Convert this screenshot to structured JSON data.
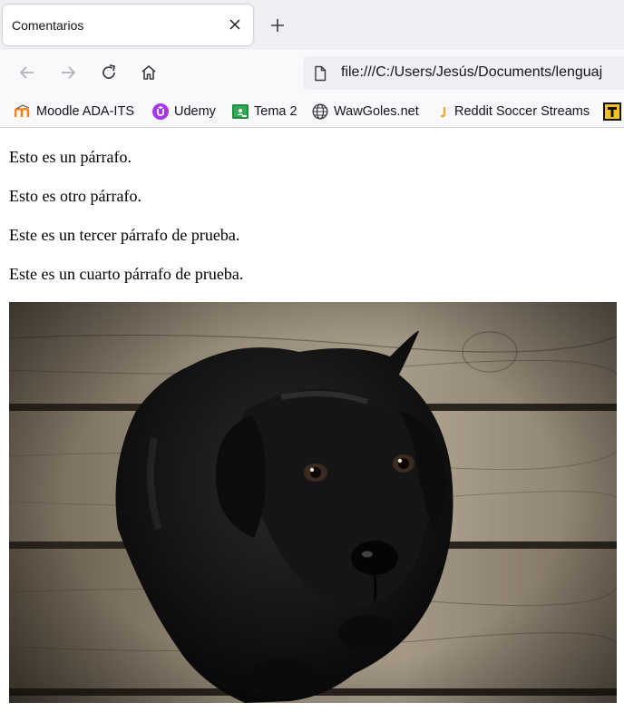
{
  "tab": {
    "title": "Comentarios"
  },
  "address_bar": {
    "url": "file:///C:/Users/Jesús/Documents/lenguaj"
  },
  "bookmarks": [
    {
      "label": "Moodle ADA-ITS",
      "icon": "moodle-icon"
    },
    {
      "label": "Udemy",
      "icon": "udemy-icon"
    },
    {
      "label": "Tema 2",
      "icon": "google-classroom-icon"
    },
    {
      "label": "WawGoles.net",
      "icon": "globe-icon"
    },
    {
      "label": "Reddit Soccer Streams",
      "icon": "reddit-soccer-icon"
    }
  ],
  "page": {
    "paragraphs": [
      "Esto es un párrafo.",
      "Esto es otro párrafo.",
      "Este es un tercer párrafo de prueba.",
      "Este es un cuarto párrafo de prueba."
    ],
    "image": {
      "subject": "black puppy on wooden floor"
    }
  },
  "colors": {
    "tabstrip": "#f0f0f4",
    "toolbar": "#f9f9fb",
    "moodle": "#f98012",
    "udemy": "#a435f0",
    "classroom": "#1e8e3e"
  }
}
